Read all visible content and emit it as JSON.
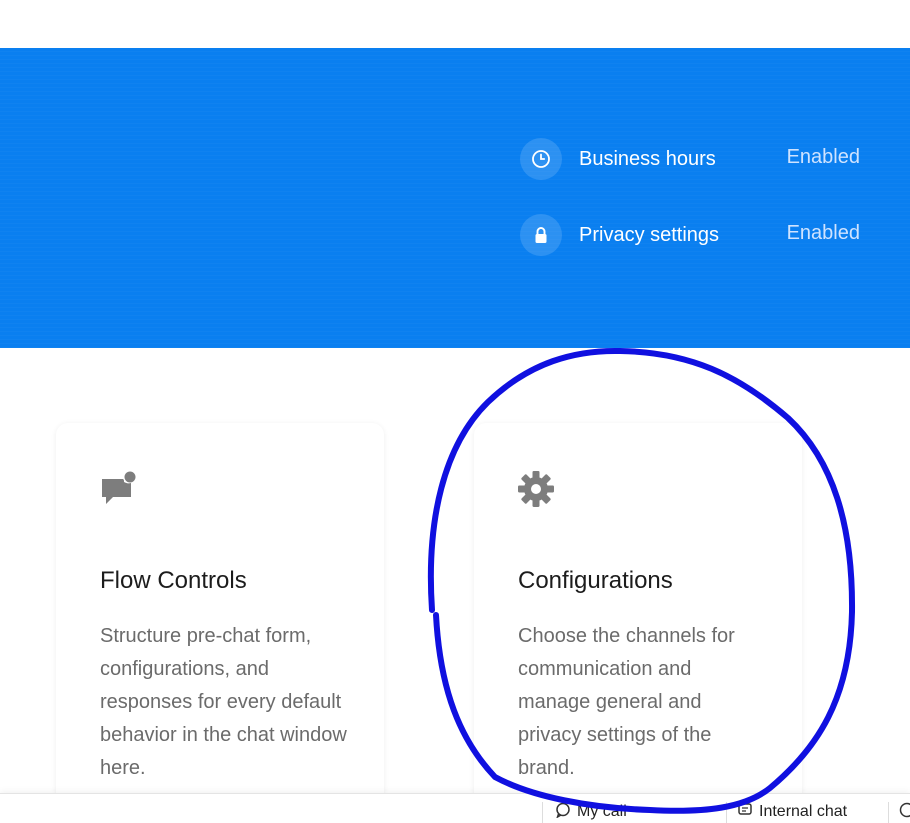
{
  "hero": {
    "rows": [
      {
        "icon": "clock-icon",
        "label": "Business hours",
        "value": "Enabled"
      },
      {
        "icon": "lock-icon",
        "label": "Privacy settings",
        "value": "Enabled"
      }
    ]
  },
  "cards": [
    {
      "icon": "chat-notification-icon",
      "title": "Flow Controls",
      "description": "Structure pre-chat form, configurations, and responses for every default behavior in the chat window here."
    },
    {
      "icon": "gear-icon",
      "title": "Configurations",
      "description": "Choose the channels for communication and manage general and privacy settings of the brand."
    }
  ],
  "bottom_bar": {
    "items": [
      {
        "icon": "chat-icon",
        "label": "My call"
      },
      {
        "icon": "message-icon",
        "label": "Internal chat"
      },
      {
        "icon": "help-icon",
        "label": ""
      }
    ]
  },
  "colors": {
    "hero_blue": "#0a7ff0",
    "annotation": "#1010e0"
  }
}
